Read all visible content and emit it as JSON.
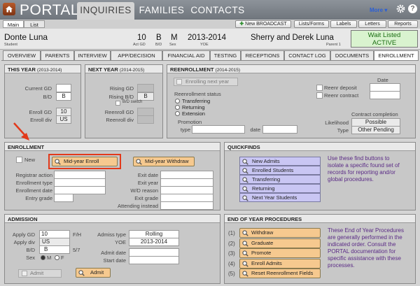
{
  "app": {
    "title": "PORTAL"
  },
  "nav": {
    "tabs": [
      "INQUIRIES",
      "FAMILIES",
      "CONTACTS"
    ],
    "more": "More"
  },
  "sub": {
    "tabs": [
      "Main",
      "List"
    ]
  },
  "toolbar": {
    "new_broadcast": "New BROADCAST",
    "lists_forms": "Lists/Forms",
    "labels": "Labels",
    "letters": "Letters",
    "reports": "Reports"
  },
  "student": {
    "name": "Donte Luna",
    "name_sub": "Student",
    "gd": "10",
    "gd_sub": "Act GD",
    "bd": "B",
    "bd_sub": "B/D",
    "sex": "M",
    "sex_sub": "Sex",
    "yoe": "2013-2014",
    "yoe_sub": "YOE",
    "parents": "Sherry and Derek Luna",
    "parents_sub": "Parent 1",
    "status1": "Wait Listed",
    "status2": "ACTIVE"
  },
  "record_tabs": [
    "OVERVIEW",
    "PARENTS",
    "INTERVIEW",
    "APP/DECISION",
    "FINANCIAL AID",
    "TESTING",
    "RECEPTIONS",
    "CONTACT LOG",
    "DOCUMENTS",
    "ENROLLMENT"
  ],
  "this_year": {
    "title": "THIS YEAR",
    "range": "(2013-2014)",
    "current_gd_label": "Current GD",
    "bd_label": "B/D",
    "bd_value": "B",
    "enroll_gd_label": "Enroll GD",
    "enroll_gd_value": "10",
    "enroll_div_label": "Enroll div",
    "enroll_div_value": "US"
  },
  "next_year": {
    "title": "NEXT YEAR",
    "range": "(2014-2015)",
    "rising_gd_label": "Rising GD",
    "rising_bd_label": "Rising B/D",
    "bd_value": "B",
    "bd_switch_label": "B/D switch",
    "reenroll_gd_label": "Reenroll GD",
    "reenroll_div_label": "Reenroll div"
  },
  "reenrollment": {
    "title": "REENROLLMENT",
    "range": "(2014-2015)",
    "enrolling_next_year": "Enrolling next year",
    "status_label": "Reenrollment status",
    "options": [
      "Transferring",
      "Returning",
      "Extension"
    ],
    "promotion_label": "Promotion",
    "type_label": "type",
    "date_label": "date",
    "date_header": "Date",
    "deposit_label": "Reenr deposit",
    "contract_label": "Reenr contract",
    "completion_label": "Contract completion",
    "likelihood_label": "Likelihood",
    "likelihood_value": "Possible",
    "type2_label": "Type",
    "type2_value": "Other Pending"
  },
  "enrollment": {
    "title": "ENROLLMENT",
    "new_label": "New",
    "midyear_enroll": "Mid-year Enroll",
    "midyear_withdraw": "Mid-year Withdraw",
    "left_fields": [
      "Registrar action",
      "Enrollment type",
      "Enrollment date",
      "Entry grade"
    ],
    "right_fields": [
      "Exit date",
      "Exit year",
      "W/D reason",
      "Exit grade",
      "Attending instead"
    ]
  },
  "quickfinds": {
    "title": "QUICKFINDS",
    "buttons": [
      "New Admits",
      "Enrolled Students",
      "Transferring",
      "Returning",
      "Next Year Students"
    ],
    "description": [
      "Use these find buttons to",
      "isolate a specific found set of",
      "records for reporting and/or",
      "global procedures."
    ]
  },
  "admission": {
    "title": "ADMISSION",
    "apply_gd_label": "Apply GD",
    "apply_gd_value": "10",
    "fh_label": "F/H",
    "apply_div_label": "Apply div",
    "apply_div_value": "US",
    "bd_label": "B/D",
    "bd_value": "B",
    "frac_label": "5/7",
    "sex_label": "Sex",
    "sex_m": "M",
    "sex_f": "F",
    "admit_check_label": "Admit",
    "admiss_type_label": "Admiss type",
    "admiss_type_value": "Rolling",
    "yoe_label": "YOE",
    "yoe_value": "2013-2014",
    "admit_date_label": "Admit date",
    "start_date_label": "Start date",
    "admit_button": "Admit"
  },
  "eoy": {
    "title": "END OF YEAR PROCEDURES",
    "steps": [
      {
        "num": "(1)",
        "label": "Withdraw"
      },
      {
        "num": "(2)",
        "label": "Graduate"
      },
      {
        "num": "(3)",
        "label": "Promote"
      },
      {
        "num": "(4)",
        "label": "Enroll Admits"
      },
      {
        "num": "(5)",
        "label": "Reset Reenrollment Fields"
      }
    ],
    "description": [
      "These End of Year Procedures",
      "are generally performed in the",
      "indicated order. Consult the",
      "PORTAL documentation for",
      "specific assistance with these",
      "processes."
    ]
  },
  "colors": {
    "accent_orange": "#f6c98f",
    "quickfind_purple": "#c9c6f3",
    "status_green": "#d9f3cf",
    "highlight_red": "#e2391a"
  }
}
